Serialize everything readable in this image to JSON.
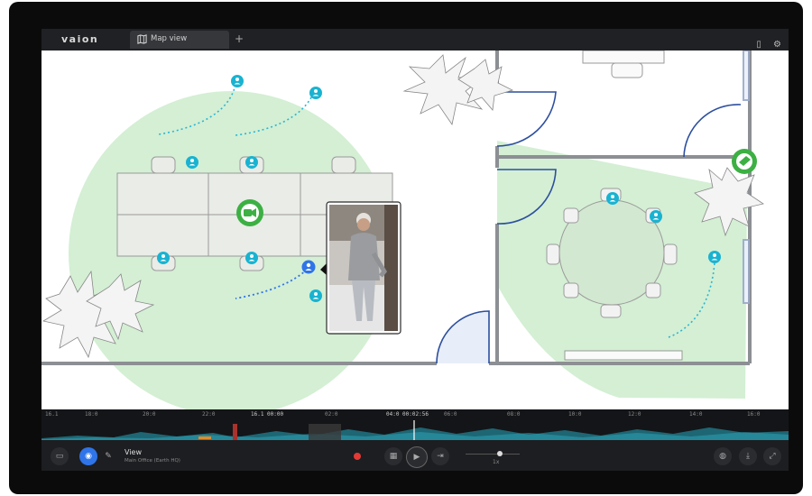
{
  "app": {
    "logo": "vaion"
  },
  "tabs": [
    {
      "label": "Map view"
    }
  ],
  "add_tab_label": "+",
  "timeline": {
    "ticks": [
      "16.1",
      "18:0",
      "20:0",
      "22:0",
      "16.1 00:00",
      "02:0",
      "04:0 00:02:56",
      "06:0",
      "08:0",
      "10:0",
      "12:0",
      "14:0",
      "16:0"
    ]
  },
  "controls": {
    "view_title": "View",
    "view_subtitle": "Main Office (Earth HQ)",
    "speed": "1x"
  },
  "colors": {
    "accent_blue": "#2f74e8",
    "camera_green": "#3cb043",
    "coverage_green": "#cdeccd",
    "person_cyan": "#19b3d1",
    "record_red": "#e53935"
  }
}
